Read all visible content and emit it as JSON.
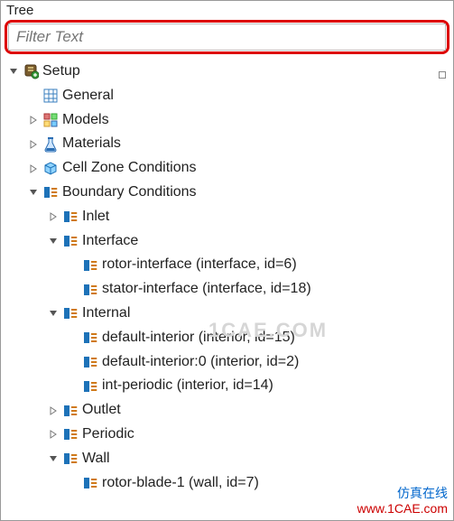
{
  "panel": {
    "title": "Tree"
  },
  "filter": {
    "placeholder": "Filter Text",
    "value": ""
  },
  "tree": {
    "setup": {
      "label": "Setup",
      "general": "General",
      "models": "Models",
      "materials": "Materials",
      "czc": "Cell Zone Conditions",
      "bc": {
        "label": "Boundary Conditions",
        "inlet": "Inlet",
        "interface": {
          "label": "Interface",
          "items": [
            "rotor-interface (interface, id=6)",
            "stator-interface (interface, id=18)"
          ]
        },
        "internal": {
          "label": "Internal",
          "items": [
            "default-interior (interior, id=15)",
            "default-interior:0 (interior, id=2)",
            "int-periodic (interior, id=14)"
          ]
        },
        "outlet": "Outlet",
        "periodic": "Periodic",
        "wall": {
          "label": "Wall",
          "items": [
            "rotor-blade-1 (wall, id=7)"
          ]
        }
      }
    }
  },
  "watermark": "1CAE.COM",
  "footer": {
    "line1": "仿真在线",
    "line2": "www.1CAE.com"
  }
}
